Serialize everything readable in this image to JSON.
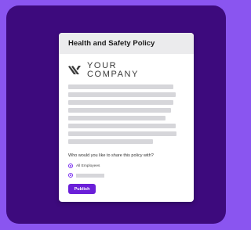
{
  "document": {
    "title": "Health and Safety Policy"
  },
  "logo": {
    "line1": "YOUR",
    "line2": "COMPANY",
    "icon": "company-logo-mark"
  },
  "share": {
    "question": "Who would you like to share this policy with?",
    "options": [
      {
        "label": "All Employees",
        "selected": true
      },
      {
        "label": "",
        "selected": false
      }
    ]
  },
  "actions": {
    "publish_label": "Publish"
  },
  "colors": {
    "page_bg": "#8a55f0",
    "frame_bg": "#3d0a7d",
    "accent": "#6a1fd8",
    "header_bg": "#ebebed",
    "placeholder": "#d6d6da"
  }
}
